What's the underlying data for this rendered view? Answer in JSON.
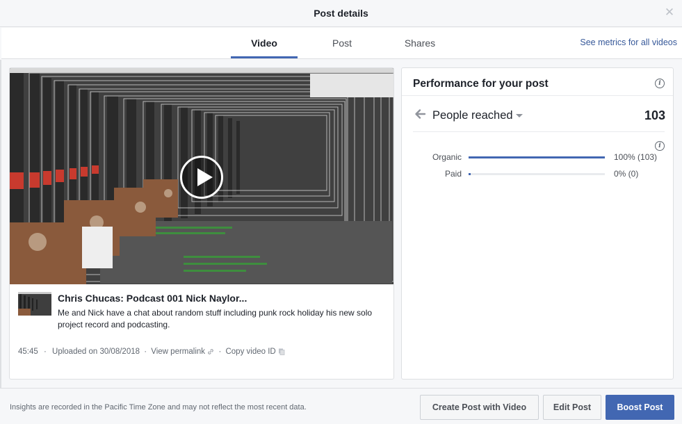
{
  "dialog": {
    "title": "Post details",
    "close_icon": "close-icon"
  },
  "tabs": [
    {
      "label": "Video",
      "active": true
    },
    {
      "label": "Post",
      "active": false
    },
    {
      "label": "Shares",
      "active": false
    }
  ],
  "see_metrics_link": "See metrics for all videos",
  "video": {
    "title": "Chris Chucas: Podcast 001 Nick Naylor...",
    "description": "Me and Nick have a chat about random stuff including punk rock holiday his new solo project record and podcasting.",
    "duration": "45:45",
    "uploaded": "Uploaded on 30/08/2018",
    "permalink_label": "View permalink",
    "copy_id_label": "Copy video ID",
    "separator": "·"
  },
  "performance": {
    "title": "Performance for your post",
    "metric_name": "People reached",
    "metric_total": "103",
    "rows": [
      {
        "label": "Organic",
        "value_text": "100% (103)",
        "fraction": 1.0
      },
      {
        "label": "Paid",
        "value_text": "0% (0)",
        "fraction": 0.0
      }
    ]
  },
  "footer": {
    "note": "Insights are recorded in the Pacific Time Zone and may not reflect the most recent data.",
    "create_button": "Create Post with Video",
    "edit_button": "Edit Post",
    "boost_button": "Boost Post"
  },
  "colors": {
    "accent": "#4267b2",
    "link": "#365899"
  }
}
